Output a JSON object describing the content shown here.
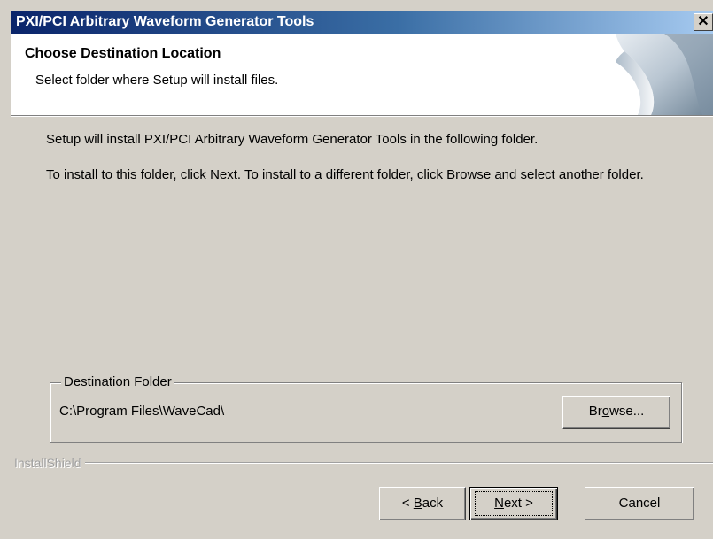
{
  "window": {
    "title": "PXI/PCI Arbitrary Waveform Generator Tools",
    "close_glyph": "✕"
  },
  "header": {
    "title": "Choose Destination Location",
    "subtitle": "Select folder where Setup will install files."
  },
  "body": {
    "line1": "Setup will install PXI/PCI Arbitrary Waveform Generator Tools in the following folder.",
    "line2": "To install to this folder, click Next. To install to a different folder, click Browse and select another folder."
  },
  "destination": {
    "group_label": "Destination Folder",
    "path": "C:\\Program Files\\WaveCad\\",
    "browse_before": "Br",
    "browse_mnemonic": "o",
    "browse_after": "wse..."
  },
  "footer": {
    "brand": "InstallShield",
    "back_prefix": "< ",
    "back_mnemonic": "B",
    "back_rest": "ack",
    "next_mnemonic": "N",
    "next_rest": "ext >",
    "cancel_label": "Cancel"
  },
  "colors": {
    "titlebar_start": "#0a246a",
    "titlebar_end": "#a6caf0",
    "dialog_face": "#d4d0c8",
    "header_bg": "#ffffff"
  },
  "icons": {
    "header_art": "installshield-curl-graphic",
    "close": "close-icon"
  }
}
